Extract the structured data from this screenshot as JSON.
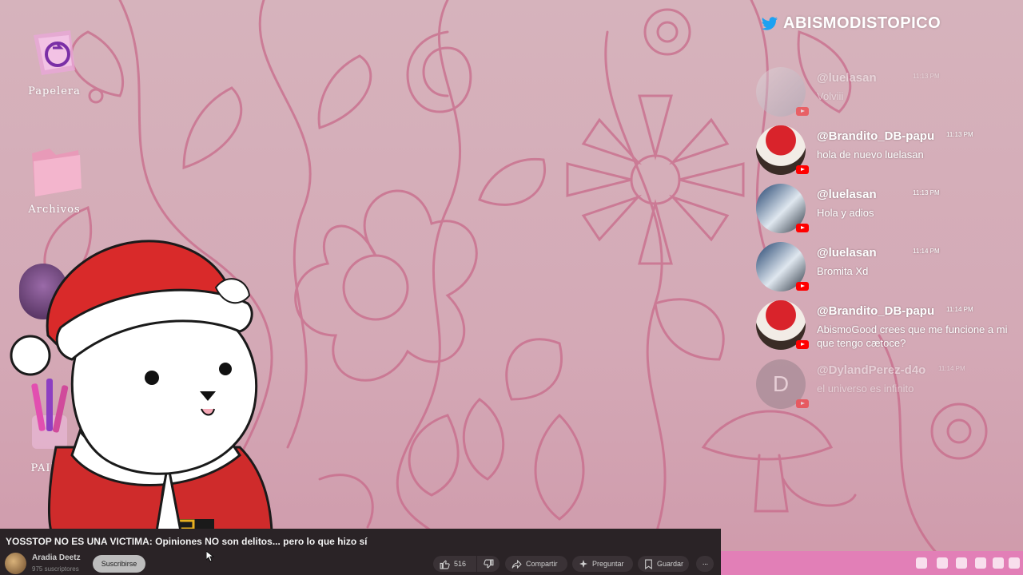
{
  "desktop": {
    "icons": [
      {
        "label": "Papelera"
      },
      {
        "label": "Archivos"
      },
      {
        "label": "PAINT"
      }
    ]
  },
  "chat": {
    "channel": "ABISMODISTOPICO",
    "messages": [
      {
        "user": "@luelasan",
        "time": "11:13 PM",
        "text": "Volviii"
      },
      {
        "user": "@Brandito_DB-papu",
        "time": "11:13 PM",
        "text": "hola de nuevo luelasan"
      },
      {
        "user": "@luelasan",
        "time": "11:13 PM",
        "text": "Hola y adios"
      },
      {
        "user": "@luelasan",
        "time": "11:14 PM",
        "text": "Bromita Xd"
      },
      {
        "user": "@Brandito_DB-papu",
        "time": "11:14 PM",
        "text": "AbismoGood crees que me funcione a mi que tengo cætoce?"
      },
      {
        "user": "@DylandPerez-d4o",
        "time": "11:14 PM",
        "text": "el universo es infinito",
        "avatar_letter": "D"
      }
    ]
  },
  "video": {
    "title": "YOSSTOP NO ES UNA VICTIMA: Opiniones NO son delitos... pero lo que hizo sí",
    "channel": "Aradia Deetz",
    "subscribers": "975 suscriptores",
    "subscribe_label": "Suscribirse",
    "likes": "516",
    "share_label": "Compartir",
    "ask_label": "Preguntar",
    "save_label": "Guardar",
    "more_label": "···"
  },
  "colors": {
    "background": "#d4adb8",
    "pattern": "#c86a8a",
    "taskbar": "#e27fb7",
    "youtube_red": "#ff0000"
  }
}
